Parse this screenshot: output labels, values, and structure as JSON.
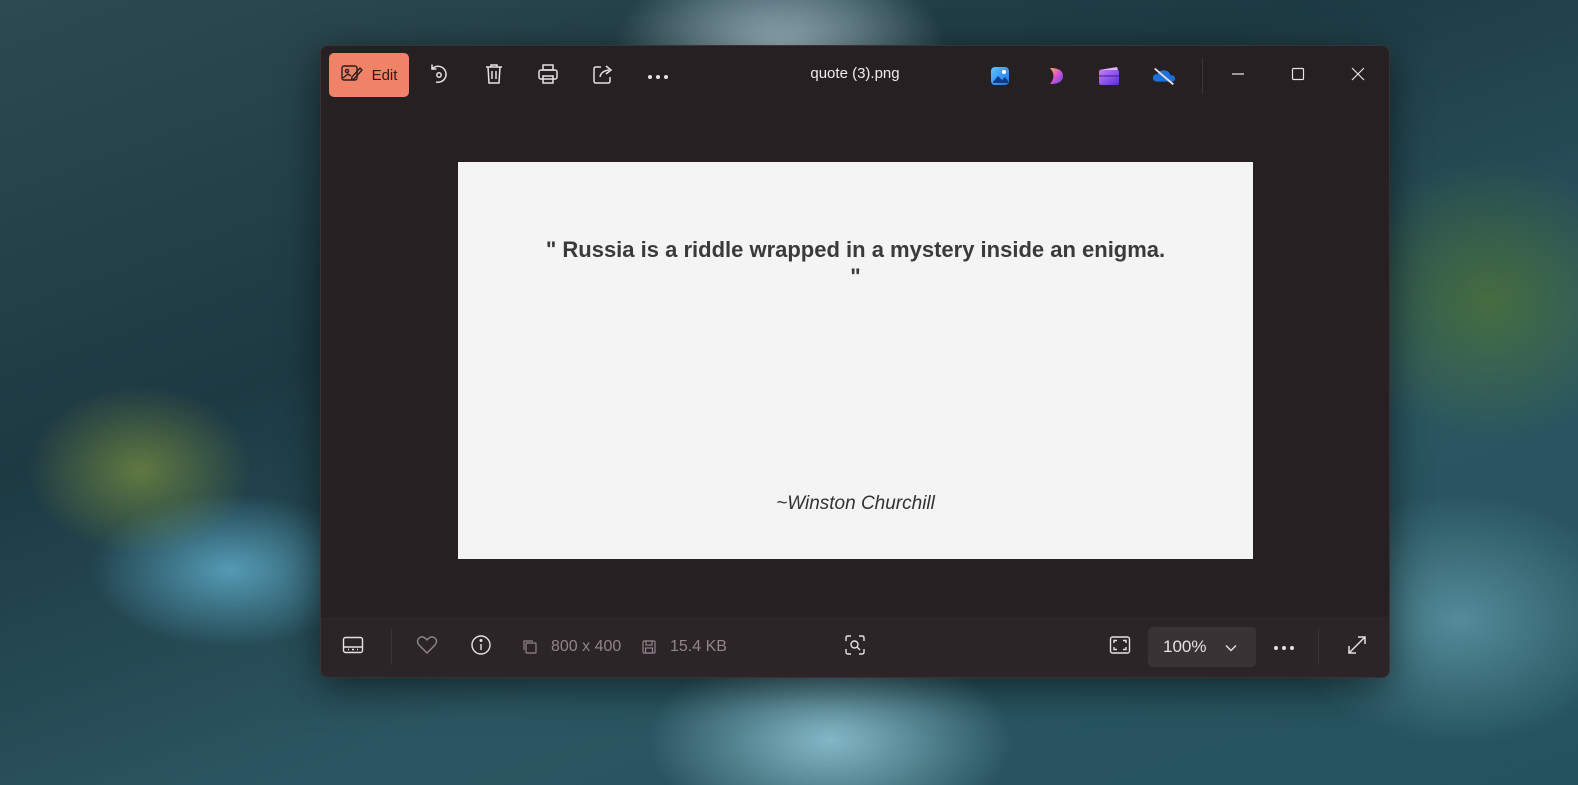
{
  "window": {
    "title": "quote (3).png",
    "toolbar": {
      "edit_label": "Edit",
      "icons": [
        "edit-image-icon",
        "rotate-icon",
        "delete-icon",
        "print-icon",
        "share-icon",
        "more-icon"
      ]
    },
    "app_icons": [
      "photos-app-icon",
      "clipchamp-icon",
      "video-editor-icon",
      "onedrive-icon"
    ],
    "window_controls": [
      "minimize-icon",
      "maximize-icon",
      "close-icon"
    ]
  },
  "image": {
    "quote_line1": "\" Russia is a riddle wrapped in a mystery inside an enigma.",
    "quote_line2": "\"",
    "author": "~Winston Churchill"
  },
  "statusbar": {
    "dimensions": "800 x 400",
    "file_size": "15.4 KB",
    "zoom": "100%"
  },
  "colors": {
    "accent": "#f08268",
    "window_bg": "#272022",
    "canvas_bg": "#f4f4f4"
  }
}
